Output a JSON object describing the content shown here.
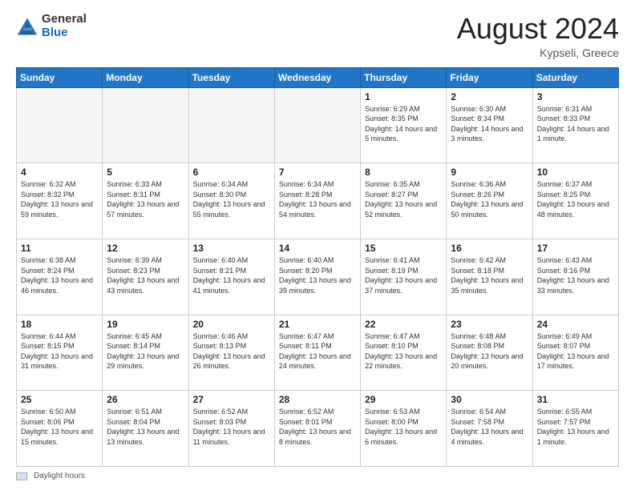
{
  "header": {
    "logo_general": "General",
    "logo_blue": "Blue",
    "month_year": "August 2024",
    "location": "Kypseli, Greece"
  },
  "footer": {
    "label": "Daylight hours"
  },
  "days_of_week": [
    "Sunday",
    "Monday",
    "Tuesday",
    "Wednesday",
    "Thursday",
    "Friday",
    "Saturday"
  ],
  "weeks": [
    [
      {
        "day": "",
        "empty": true
      },
      {
        "day": "",
        "empty": true
      },
      {
        "day": "",
        "empty": true
      },
      {
        "day": "",
        "empty": true
      },
      {
        "day": "1",
        "sunrise": "6:29 AM",
        "sunset": "8:35 PM",
        "daylight": "14 hours and 5 minutes."
      },
      {
        "day": "2",
        "sunrise": "6:30 AM",
        "sunset": "8:34 PM",
        "daylight": "14 hours and 3 minutes."
      },
      {
        "day": "3",
        "sunrise": "6:31 AM",
        "sunset": "8:33 PM",
        "daylight": "14 hours and 1 minute."
      }
    ],
    [
      {
        "day": "4",
        "sunrise": "6:32 AM",
        "sunset": "8:32 PM",
        "daylight": "13 hours and 59 minutes."
      },
      {
        "day": "5",
        "sunrise": "6:33 AM",
        "sunset": "8:31 PM",
        "daylight": "13 hours and 57 minutes."
      },
      {
        "day": "6",
        "sunrise": "6:34 AM",
        "sunset": "8:30 PM",
        "daylight": "13 hours and 55 minutes."
      },
      {
        "day": "7",
        "sunrise": "6:34 AM",
        "sunset": "8:28 PM",
        "daylight": "13 hours and 54 minutes."
      },
      {
        "day": "8",
        "sunrise": "6:35 AM",
        "sunset": "8:27 PM",
        "daylight": "13 hours and 52 minutes."
      },
      {
        "day": "9",
        "sunrise": "6:36 AM",
        "sunset": "8:26 PM",
        "daylight": "13 hours and 50 minutes."
      },
      {
        "day": "10",
        "sunrise": "6:37 AM",
        "sunset": "8:25 PM",
        "daylight": "13 hours and 48 minutes."
      }
    ],
    [
      {
        "day": "11",
        "sunrise": "6:38 AM",
        "sunset": "8:24 PM",
        "daylight": "13 hours and 46 minutes."
      },
      {
        "day": "12",
        "sunrise": "6:39 AM",
        "sunset": "8:23 PM",
        "daylight": "13 hours and 43 minutes."
      },
      {
        "day": "13",
        "sunrise": "6:40 AM",
        "sunset": "8:21 PM",
        "daylight": "13 hours and 41 minutes."
      },
      {
        "day": "14",
        "sunrise": "6:40 AM",
        "sunset": "8:20 PM",
        "daylight": "13 hours and 39 minutes."
      },
      {
        "day": "15",
        "sunrise": "6:41 AM",
        "sunset": "8:19 PM",
        "daylight": "13 hours and 37 minutes."
      },
      {
        "day": "16",
        "sunrise": "6:42 AM",
        "sunset": "8:18 PM",
        "daylight": "13 hours and 35 minutes."
      },
      {
        "day": "17",
        "sunrise": "6:43 AM",
        "sunset": "8:16 PM",
        "daylight": "13 hours and 33 minutes."
      }
    ],
    [
      {
        "day": "18",
        "sunrise": "6:44 AM",
        "sunset": "8:15 PM",
        "daylight": "13 hours and 31 minutes."
      },
      {
        "day": "19",
        "sunrise": "6:45 AM",
        "sunset": "8:14 PM",
        "daylight": "13 hours and 29 minutes."
      },
      {
        "day": "20",
        "sunrise": "6:46 AM",
        "sunset": "8:13 PM",
        "daylight": "13 hours and 26 minutes."
      },
      {
        "day": "21",
        "sunrise": "6:47 AM",
        "sunset": "8:11 PM",
        "daylight": "13 hours and 24 minutes."
      },
      {
        "day": "22",
        "sunrise": "6:47 AM",
        "sunset": "8:10 PM",
        "daylight": "13 hours and 22 minutes."
      },
      {
        "day": "23",
        "sunrise": "6:48 AM",
        "sunset": "8:08 PM",
        "daylight": "13 hours and 20 minutes."
      },
      {
        "day": "24",
        "sunrise": "6:49 AM",
        "sunset": "8:07 PM",
        "daylight": "13 hours and 17 minutes."
      }
    ],
    [
      {
        "day": "25",
        "sunrise": "6:50 AM",
        "sunset": "8:06 PM",
        "daylight": "13 hours and 15 minutes."
      },
      {
        "day": "26",
        "sunrise": "6:51 AM",
        "sunset": "8:04 PM",
        "daylight": "13 hours and 13 minutes."
      },
      {
        "day": "27",
        "sunrise": "6:52 AM",
        "sunset": "8:03 PM",
        "daylight": "13 hours and 11 minutes."
      },
      {
        "day": "28",
        "sunrise": "6:52 AM",
        "sunset": "8:01 PM",
        "daylight": "13 hours and 8 minutes."
      },
      {
        "day": "29",
        "sunrise": "6:53 AM",
        "sunset": "8:00 PM",
        "daylight": "13 hours and 6 minutes."
      },
      {
        "day": "30",
        "sunrise": "6:54 AM",
        "sunset": "7:58 PM",
        "daylight": "13 hours and 4 minutes."
      },
      {
        "day": "31",
        "sunrise": "6:55 AM",
        "sunset": "7:57 PM",
        "daylight": "13 hours and 1 minute."
      }
    ]
  ]
}
